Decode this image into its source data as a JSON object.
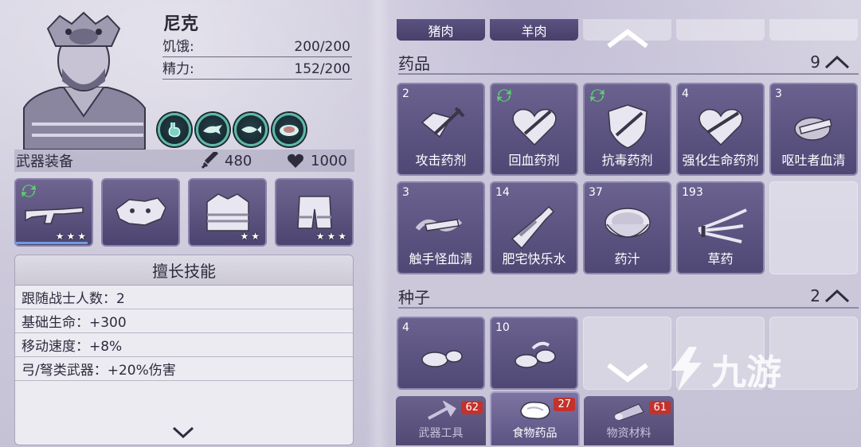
{
  "character": {
    "name": "尼克",
    "hunger_label": "饥饿:",
    "hunger_value": "200/200",
    "energy_label": "精力:",
    "energy_value": "152/200"
  },
  "buffs": [
    "stomach-icon",
    "animal-icon",
    "fish-icon",
    "meat-plate-icon"
  ],
  "equipment": {
    "title": "武器装备",
    "attack": "480",
    "health": "1000",
    "slots": [
      {
        "name": "rifle",
        "stars": "★★★"
      },
      {
        "name": "boar-mask",
        "stars": ""
      },
      {
        "name": "jacket",
        "stars": "★★"
      },
      {
        "name": "shorts",
        "stars": "★★★"
      }
    ]
  },
  "skills": {
    "title": "擅长技能",
    "rows": [
      "跟随战士人数：2",
      "基础生命：+300",
      "移动速度：+8%",
      "弓/弩类武器：+20%伤害"
    ]
  },
  "top_row": [
    "猪肉",
    "羊肉"
  ],
  "sections": [
    {
      "title": "药品",
      "count": "9"
    },
    {
      "title": "种子",
      "count": "2"
    }
  ],
  "medicine": [
    {
      "qty": "2",
      "name": "攻击药剂"
    },
    {
      "qty": "",
      "name": "回血药剂"
    },
    {
      "qty": "",
      "name": "抗毒药剂"
    },
    {
      "qty": "4",
      "name": "强化生命药剂"
    },
    {
      "qty": "3",
      "name": "呕吐者血清"
    },
    {
      "qty": "3",
      "name": "触手怪血清"
    },
    {
      "qty": "14",
      "name": "肥宅快乐水"
    },
    {
      "qty": "37",
      "name": "药汁"
    },
    {
      "qty": "193",
      "name": "草药"
    }
  ],
  "seeds": [
    {
      "qty": "4"
    },
    {
      "qty": "10"
    }
  ],
  "tabs": [
    {
      "label": "武器工具",
      "badge": "62"
    },
    {
      "label": "食物药品",
      "badge": "27"
    },
    {
      "label": "物资材料",
      "badge": "61"
    }
  ],
  "watermark": "九游",
  "colors": {
    "cell": "#5b5380",
    "badge": "#c3322b",
    "buff_ring": "#5fb8a8"
  }
}
